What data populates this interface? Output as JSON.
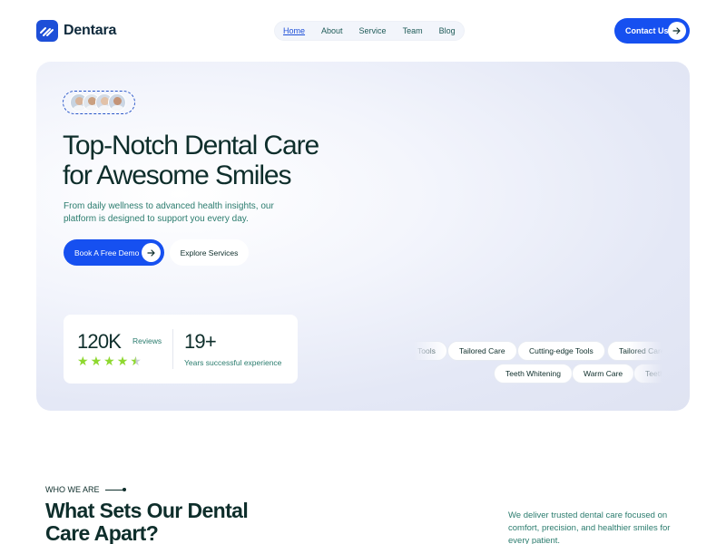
{
  "brand": {
    "name": "Dentara"
  },
  "nav": {
    "items": [
      {
        "label": "Home",
        "active": true
      },
      {
        "label": "About"
      },
      {
        "label": "Service"
      },
      {
        "label": "Team"
      },
      {
        "label": "Blog"
      }
    ]
  },
  "header": {
    "contact_label": "Contact Us"
  },
  "hero": {
    "title_line1": "Top-Notch Dental Care",
    "title_line2": "for Awesome Smiles",
    "description": "From daily wellness to advanced health insights, our platform is designed to support you every day.",
    "primary_button": "Book A Free Demo",
    "secondary_button": "Explore Services",
    "stats": {
      "reviews_value": "120K",
      "reviews_label": "Reviews",
      "rating_stars": 4.5,
      "years_value": "19+",
      "years_label": "Years successful experience"
    },
    "tags_row1": [
      "Tools",
      "Tailored Care",
      "Cutting-edge Tools",
      "Tailored Care"
    ],
    "tags_row2": [
      "Teeth Whitening",
      "Warm Care",
      "Teeth Whitening"
    ]
  },
  "section": {
    "eyebrow": "WHO WE ARE",
    "title_line1": "What Sets Our Dental",
    "title_line2": "Care Apart?",
    "description": "We deliver trusted dental care focused on comfort, precision, and healthier smiles for every patient."
  },
  "colors": {
    "primary": "#1650f0",
    "text_dark": "#0e2e2b",
    "text_teal": "#2b7c6e",
    "star": "#8ed82f"
  }
}
